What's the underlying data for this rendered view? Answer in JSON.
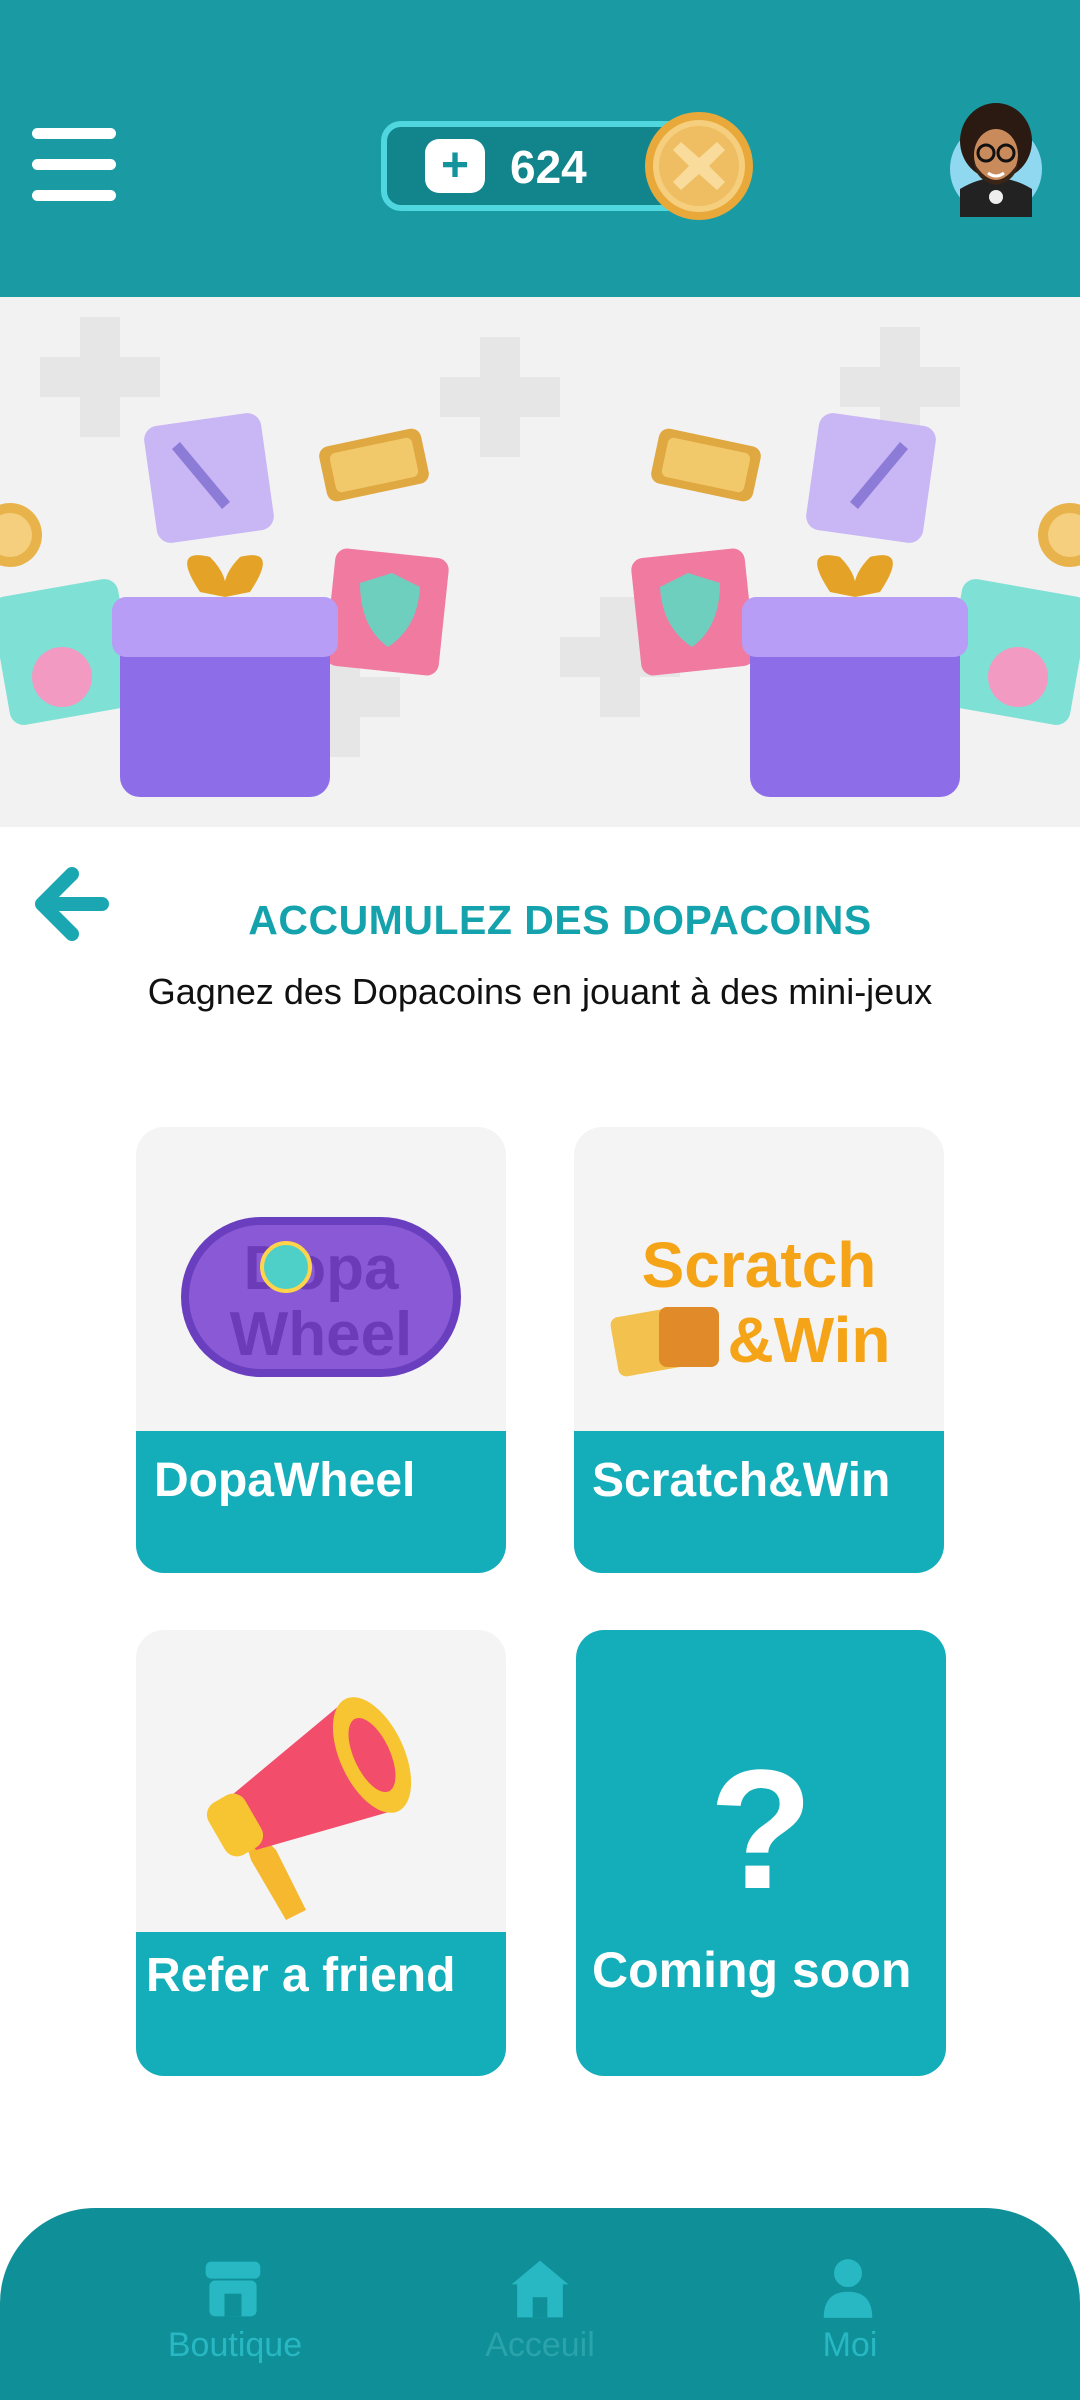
{
  "header": {
    "menu_icon": "hamburger-menu-icon",
    "add_icon": "plus-icon",
    "add_label": "+",
    "coin_count": "624",
    "coin_icon": "dopacoin-icon",
    "avatar_icon": "user-avatar"
  },
  "section": {
    "back_icon": "arrow-left-icon",
    "title": "ACCUMULEZ DES DOPACOINS",
    "subtitle": "Gagnez des Dopacoins en jouant à des mini-jeux"
  },
  "games": [
    {
      "label": "DopaWheel",
      "logo_line1": "Dopa",
      "logo_line2": "Wheel"
    },
    {
      "label": "Scratch&Win",
      "logo_line1": "Scratch",
      "logo_line2": "&Win"
    },
    {
      "label": "Refer a friend",
      "icon": "megaphone-icon"
    },
    {
      "label": "Coming soon",
      "symbol": "?"
    }
  ],
  "bottom_nav": {
    "items": [
      {
        "label": "Boutique",
        "icon": "store-icon"
      },
      {
        "label": "Acceuil",
        "icon": "home-icon"
      },
      {
        "label": "Moi",
        "icon": "person-icon"
      }
    ]
  },
  "colors": {
    "header_bg": "#1a9ba3",
    "accent": "#14aeba",
    "title": "#14a3ad",
    "nav_bg": "#0f8f98",
    "coin_gold": "#e8b34a"
  }
}
